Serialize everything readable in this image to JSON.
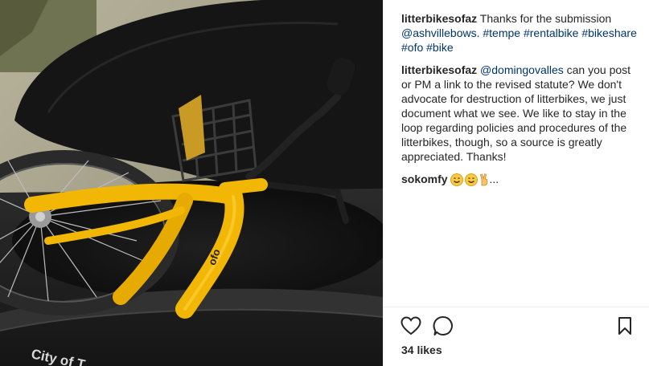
{
  "comments": [
    {
      "username": "litterbikesofaz",
      "text_before": " Thanks for the submission ",
      "tags": [
        "@ashvillebows.",
        "#tempe",
        "#rentalbike",
        "#bikeshare",
        "#ofo",
        "#bike"
      ]
    },
    {
      "username": "litterbikesofaz",
      "mention": "@domingovalles",
      "text": " can you post or PM a link to the revised statute? We don't advocate for destruction of litterbikes, we just document what we see. We like to stay in the loop regarding policies and procedures of the litterbikes, though, so a source is greatly appreciated. Thanks!"
    },
    {
      "username": "sokomfy",
      "emojis": [
        "smiling-face-emoji",
        "smiling-face-emoji",
        "victory-hand-emoji"
      ],
      "suffix": "..."
    }
  ],
  "likes": "34 likes",
  "photo": {
    "bin_label": "City of T",
    "bike_brand": "ofo"
  },
  "icons": {
    "like": "heart-icon",
    "comment": "comment-bubble-icon",
    "save": "bookmark-icon"
  },
  "colors": {
    "link": "#003569",
    "text": "#262626",
    "bike_yellow": "#f2b705"
  }
}
